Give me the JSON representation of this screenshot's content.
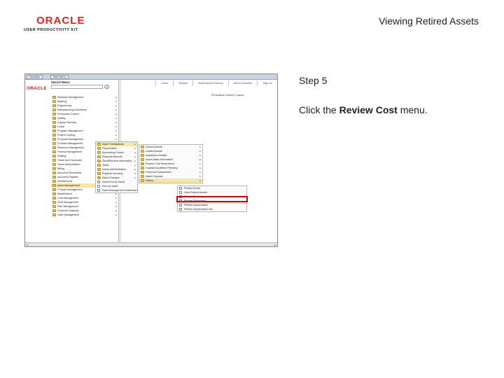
{
  "slide": {
    "logo_word": "ORACLE",
    "logo_sub": "USER PRODUCTIVITY KIT",
    "title": "Viewing Retired Assets",
    "step": "Step 5",
    "instruction_prefix": "Click the ",
    "instruction_target": "Review Cost",
    "instruction_suffix": " menu."
  },
  "app": {
    "tabs": [
      "Favorites",
      "Main Menu"
    ],
    "brand": "ORACLE",
    "nav": [
      "Home",
      "Worklist",
      "MultiChannel Console",
      "Add to Favorites",
      "Sign out"
    ],
    "menu_title": "Search Menu:",
    "search_button": "»",
    "personalize": "Personalize Content | Layout"
  },
  "menu_main": [
    {
      "label": "Directory Management",
      "sub": true
    },
    {
      "label": "Banking",
      "sub": true
    },
    {
      "label": "Engineering",
      "sub": true
    },
    {
      "label": "Manufacturing Definitions",
      "sub": true
    },
    {
      "label": "Production Control",
      "sub": true
    },
    {
      "label": "Quality",
      "sub": true
    },
    {
      "label": "Supply Planning",
      "sub": true
    },
    {
      "label": "Lease",
      "sub": true
    },
    {
      "label": "Program Management",
      "sub": true
    },
    {
      "label": "Project Costing",
      "sub": true
    },
    {
      "label": "Proposal Management",
      "sub": true
    },
    {
      "label": "Contract Management",
      "sub": true
    },
    {
      "label": "Resource Management",
      "sub": true
    },
    {
      "label": "Federal Management",
      "sub": true
    },
    {
      "label": "Staffing",
      "sub": true
    },
    {
      "label": "Travel and Expenses",
      "sub": true
    },
    {
      "label": "Travel Authorization",
      "sub": true
    },
    {
      "label": "Billing",
      "sub": true
    },
    {
      "label": "Accounts Receivable",
      "sub": true
    },
    {
      "label": "Accounts Payable",
      "sub": true
    },
    {
      "label": "eSettlements",
      "sub": true
    },
    {
      "label": "Asset Management",
      "sub": true,
      "sel": true
    },
    {
      "label": "IT Asset Management",
      "sub": true
    },
    {
      "label": "Maintenance",
      "sub": true
    },
    {
      "label": "Cost Management",
      "sub": true
    },
    {
      "label": "Deal Management",
      "sub": true
    },
    {
      "label": "Risk Management",
      "sub": true
    },
    {
      "label": "Financial Gateway",
      "sub": true
    },
    {
      "label": "Cash Management",
      "sub": true
    }
  ],
  "menu_asset": [
    {
      "label": "Asset Transactions",
      "sub": true,
      "sel": true
    },
    {
      "label": "Depreciation",
      "sub": true
    },
    {
      "label": "Accounting Entries",
      "sub": true
    },
    {
      "label": "Financial Reports",
      "sub": true
    },
    {
      "label": "Send/Receive Information",
      "sub": true
    },
    {
      "label": "Taxes",
      "sub": true
    },
    {
      "label": "Lease Administration",
      "sub": true
    },
    {
      "label": "Physical Inventory",
      "sub": true
    },
    {
      "label": "Mass Changes",
      "sub": true
    },
    {
      "label": "Search for an Asset",
      "doc": true
    },
    {
      "label": "Find an Asset",
      "doc": true
    },
    {
      "label": "Asset Management Dashboard",
      "doc": true
    }
  ],
  "menu_transactions": [
    {
      "label": "Owned Assets",
      "sub": true
    },
    {
      "label": "Leased Assets",
      "sub": true
    },
    {
      "label": "Acquisition Details",
      "sub": true
    },
    {
      "label": "Asset Basic Information",
      "sub": true
    },
    {
      "label": "Review Cost Parameters",
      "sub": true
    },
    {
      "label": "Capital Acquisition Planning",
      "sub": true
    },
    {
      "label": "Financial Transactions",
      "sub": true
    },
    {
      "label": "Asset Disposal",
      "sub": true
    },
    {
      "label": "History",
      "sub": true,
      "sel": true
    }
  ],
  "menu_history": [
    {
      "label": "Review Books",
      "doc": true
    },
    {
      "label": "View Retired Assets",
      "doc": true
    },
    {
      "label": "Review Cost",
      "doc": true,
      "hl": true
    },
    {
      "label": "Review Retirement",
      "doc": true
    },
    {
      "label": "Review Depreciation",
      "doc": true
    },
    {
      "label": "Review Depreciation Info",
      "doc": true
    }
  ]
}
